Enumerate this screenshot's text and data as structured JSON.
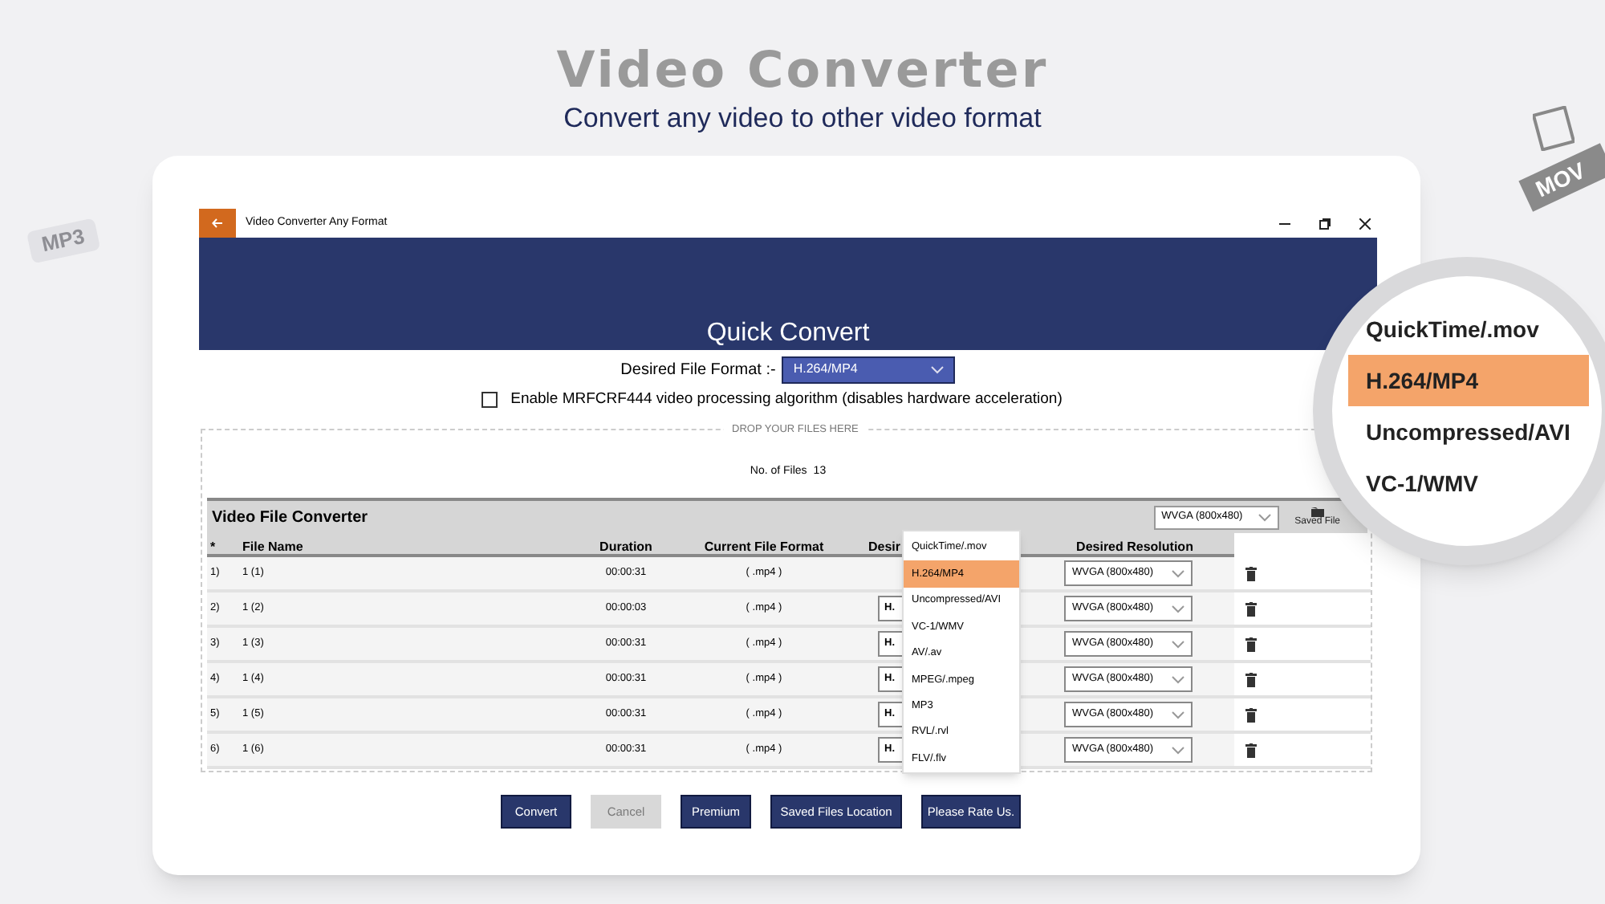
{
  "banner": {
    "title": "Video Converter",
    "subtitle": "Convert any video to other video format"
  },
  "decor_badges": [
    "MP3",
    "MOV"
  ],
  "window": {
    "title": "Video Converter Any Format",
    "header": "Quick Convert",
    "format_label": "Desired File Format :-",
    "format_value": "H.264/MP4",
    "mrf_option": {
      "label": "Enable MRFCRF444 video processing algorithm (disables hardware acceleration)",
      "checked": false
    },
    "drop_zone": {
      "legend": "DROP YOUR FILES HERE",
      "file_count_label": "No. of Files",
      "file_count": "13"
    },
    "table": {
      "title": "Video File Converter",
      "resolution": "WVGA (800x480)",
      "saved_file": "Saved File",
      "columns": [
        "*",
        "File Name",
        "Duration",
        "Current File Format",
        "Desir",
        "Desired Resolution"
      ],
      "rows": [
        {
          "index": "1)",
          "name": "1 (1)",
          "duration": "00:00:31",
          "format": "( .mp4 )",
          "resolution": "WVGA (800x480)"
        },
        {
          "index": "2)",
          "name": "1 (2)",
          "duration": "00:00:03",
          "format": "( .mp4 )",
          "target": "H.",
          "resolution": "WVGA (800x480)"
        },
        {
          "index": "3)",
          "name": "1 (3)",
          "duration": "00:00:31",
          "format": "( .mp4 )",
          "target": "H.",
          "resolution": "WVGA (800x480)"
        },
        {
          "index": "4)",
          "name": "1 (4)",
          "duration": "00:00:31",
          "format": "( .mp4 )",
          "target": "H.",
          "resolution": "WVGA (800x480)"
        },
        {
          "index": "5)",
          "name": "1 (5)",
          "duration": "00:00:31",
          "format": "( .mp4 )",
          "target": "H.",
          "resolution": "WVGA (800x480)"
        },
        {
          "index": "6)",
          "name": "1 (6)",
          "duration": "00:00:31",
          "format": "( .mp4 )",
          "target": "H.",
          "resolution": "WVGA (800x480)"
        }
      ]
    },
    "format_menu": [
      {
        "label": "QuickTime/.mov",
        "selected": false
      },
      {
        "label": "H.264/MP4",
        "selected": true
      },
      {
        "label": "Uncompressed/AVI",
        "selected": false
      },
      {
        "label": "VC-1/WMV",
        "selected": false
      },
      {
        "label": "AV/.av",
        "selected": false
      },
      {
        "label": "MPEG/.mpeg",
        "selected": false
      },
      {
        "label": "MP3",
        "selected": false
      },
      {
        "label": "RVL/.rvl",
        "selected": false
      },
      {
        "label": "FLV/.flv",
        "selected": false
      }
    ],
    "buttons": [
      {
        "label": "Convert",
        "disabled": false
      },
      {
        "label": "Cancel",
        "disabled": true
      },
      {
        "label": "Premium",
        "disabled": false
      },
      {
        "label": "Saved Files Location",
        "disabled": false
      },
      {
        "label": "Please Rate Us.",
        "disabled": false
      }
    ]
  },
  "magnifier": {
    "items": [
      {
        "label": "QuickTime/.mov",
        "selected": false
      },
      {
        "label": "H.264/MP4",
        "selected": true
      },
      {
        "label": "Uncompressed/AVI",
        "selected": false
      },
      {
        "label": "VC-1/WMV",
        "selected": false
      }
    ]
  }
}
